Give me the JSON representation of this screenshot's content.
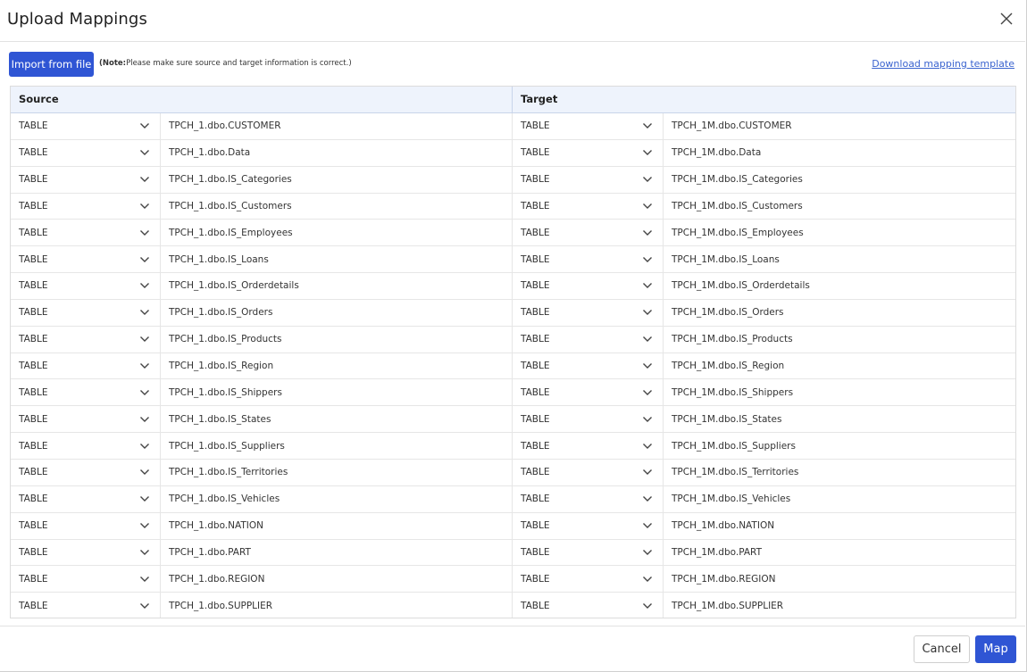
{
  "dialog": {
    "title": "Upload Mappings"
  },
  "toolbar": {
    "import_label": "Import from file",
    "note_prefix": "(Note:",
    "note_text": "Please make sure source and target information is correct.)",
    "template_link": "Download mapping template"
  },
  "grid": {
    "source_header": "Source",
    "target_header": "Target",
    "rows": [
      {
        "source_type": "TABLE",
        "source_name": "TPCH_1.dbo.CUSTOMER",
        "target_type": "TABLE",
        "target_name": "TPCH_1M.dbo.CUSTOMER"
      },
      {
        "source_type": "TABLE",
        "source_name": "TPCH_1.dbo.Data",
        "target_type": "TABLE",
        "target_name": "TPCH_1M.dbo.Data"
      },
      {
        "source_type": "TABLE",
        "source_name": "TPCH_1.dbo.IS_Categories",
        "target_type": "TABLE",
        "target_name": "TPCH_1M.dbo.IS_Categories"
      },
      {
        "source_type": "TABLE",
        "source_name": "TPCH_1.dbo.IS_Customers",
        "target_type": "TABLE",
        "target_name": "TPCH_1M.dbo.IS_Customers"
      },
      {
        "source_type": "TABLE",
        "source_name": "TPCH_1.dbo.IS_Employees",
        "target_type": "TABLE",
        "target_name": "TPCH_1M.dbo.IS_Employees"
      },
      {
        "source_type": "TABLE",
        "source_name": "TPCH_1.dbo.IS_Loans",
        "target_type": "TABLE",
        "target_name": "TPCH_1M.dbo.IS_Loans"
      },
      {
        "source_type": "TABLE",
        "source_name": "TPCH_1.dbo.IS_Orderdetails",
        "target_type": "TABLE",
        "target_name": "TPCH_1M.dbo.IS_Orderdetails"
      },
      {
        "source_type": "TABLE",
        "source_name": "TPCH_1.dbo.IS_Orders",
        "target_type": "TABLE",
        "target_name": "TPCH_1M.dbo.IS_Orders"
      },
      {
        "source_type": "TABLE",
        "source_name": "TPCH_1.dbo.IS_Products",
        "target_type": "TABLE",
        "target_name": "TPCH_1M.dbo.IS_Products"
      },
      {
        "source_type": "TABLE",
        "source_name": "TPCH_1.dbo.IS_Region",
        "target_type": "TABLE",
        "target_name": "TPCH_1M.dbo.IS_Region"
      },
      {
        "source_type": "TABLE",
        "source_name": "TPCH_1.dbo.IS_Shippers",
        "target_type": "TABLE",
        "target_name": "TPCH_1M.dbo.IS_Shippers"
      },
      {
        "source_type": "TABLE",
        "source_name": "TPCH_1.dbo.IS_States",
        "target_type": "TABLE",
        "target_name": "TPCH_1M.dbo.IS_States"
      },
      {
        "source_type": "TABLE",
        "source_name": "TPCH_1.dbo.IS_Suppliers",
        "target_type": "TABLE",
        "target_name": "TPCH_1M.dbo.IS_Suppliers"
      },
      {
        "source_type": "TABLE",
        "source_name": "TPCH_1.dbo.IS_Territories",
        "target_type": "TABLE",
        "target_name": "TPCH_1M.dbo.IS_Territories"
      },
      {
        "source_type": "TABLE",
        "source_name": "TPCH_1.dbo.IS_Vehicles",
        "target_type": "TABLE",
        "target_name": "TPCH_1M.dbo.IS_Vehicles"
      },
      {
        "source_type": "TABLE",
        "source_name": "TPCH_1.dbo.NATION",
        "target_type": "TABLE",
        "target_name": "TPCH_1M.dbo.NATION"
      },
      {
        "source_type": "TABLE",
        "source_name": "TPCH_1.dbo.PART",
        "target_type": "TABLE",
        "target_name": "TPCH_1M.dbo.PART"
      },
      {
        "source_type": "TABLE",
        "source_name": "TPCH_1.dbo.REGION",
        "target_type": "TABLE",
        "target_name": "TPCH_1M.dbo.REGION"
      },
      {
        "source_type": "TABLE",
        "source_name": "TPCH_1.dbo.SUPPLIER",
        "target_type": "TABLE",
        "target_name": "TPCH_1M.dbo.SUPPLIER"
      }
    ]
  },
  "footer": {
    "cancel_label": "Cancel",
    "map_label": "Map"
  },
  "icons": {
    "close": "close-icon",
    "dropdown": "chevron-down-icon"
  },
  "colors": {
    "primary": "#2f55d4",
    "link": "#3a63cf",
    "header_bg": "#eef3fc"
  }
}
